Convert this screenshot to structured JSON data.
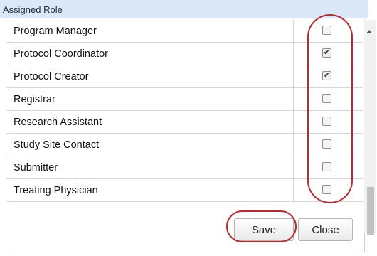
{
  "header": {
    "title": "Assigned Role"
  },
  "roles": [
    {
      "label": "Program Manager",
      "checked": false
    },
    {
      "label": "Protocol Coordinator",
      "checked": true
    },
    {
      "label": "Protocol Creator",
      "checked": true
    },
    {
      "label": "Registrar",
      "checked": false
    },
    {
      "label": "Research Assistant",
      "checked": false
    },
    {
      "label": "Study Site Contact",
      "checked": false
    },
    {
      "label": "Submitter",
      "checked": false
    },
    {
      "label": "Treating Physician",
      "checked": false
    }
  ],
  "footer": {
    "save_label": "Save",
    "close_label": "Close"
  },
  "icons": {
    "checkmark": "✔"
  },
  "colors": {
    "annotation": "#c0282d",
    "header_bg": "#dbe8f7"
  }
}
